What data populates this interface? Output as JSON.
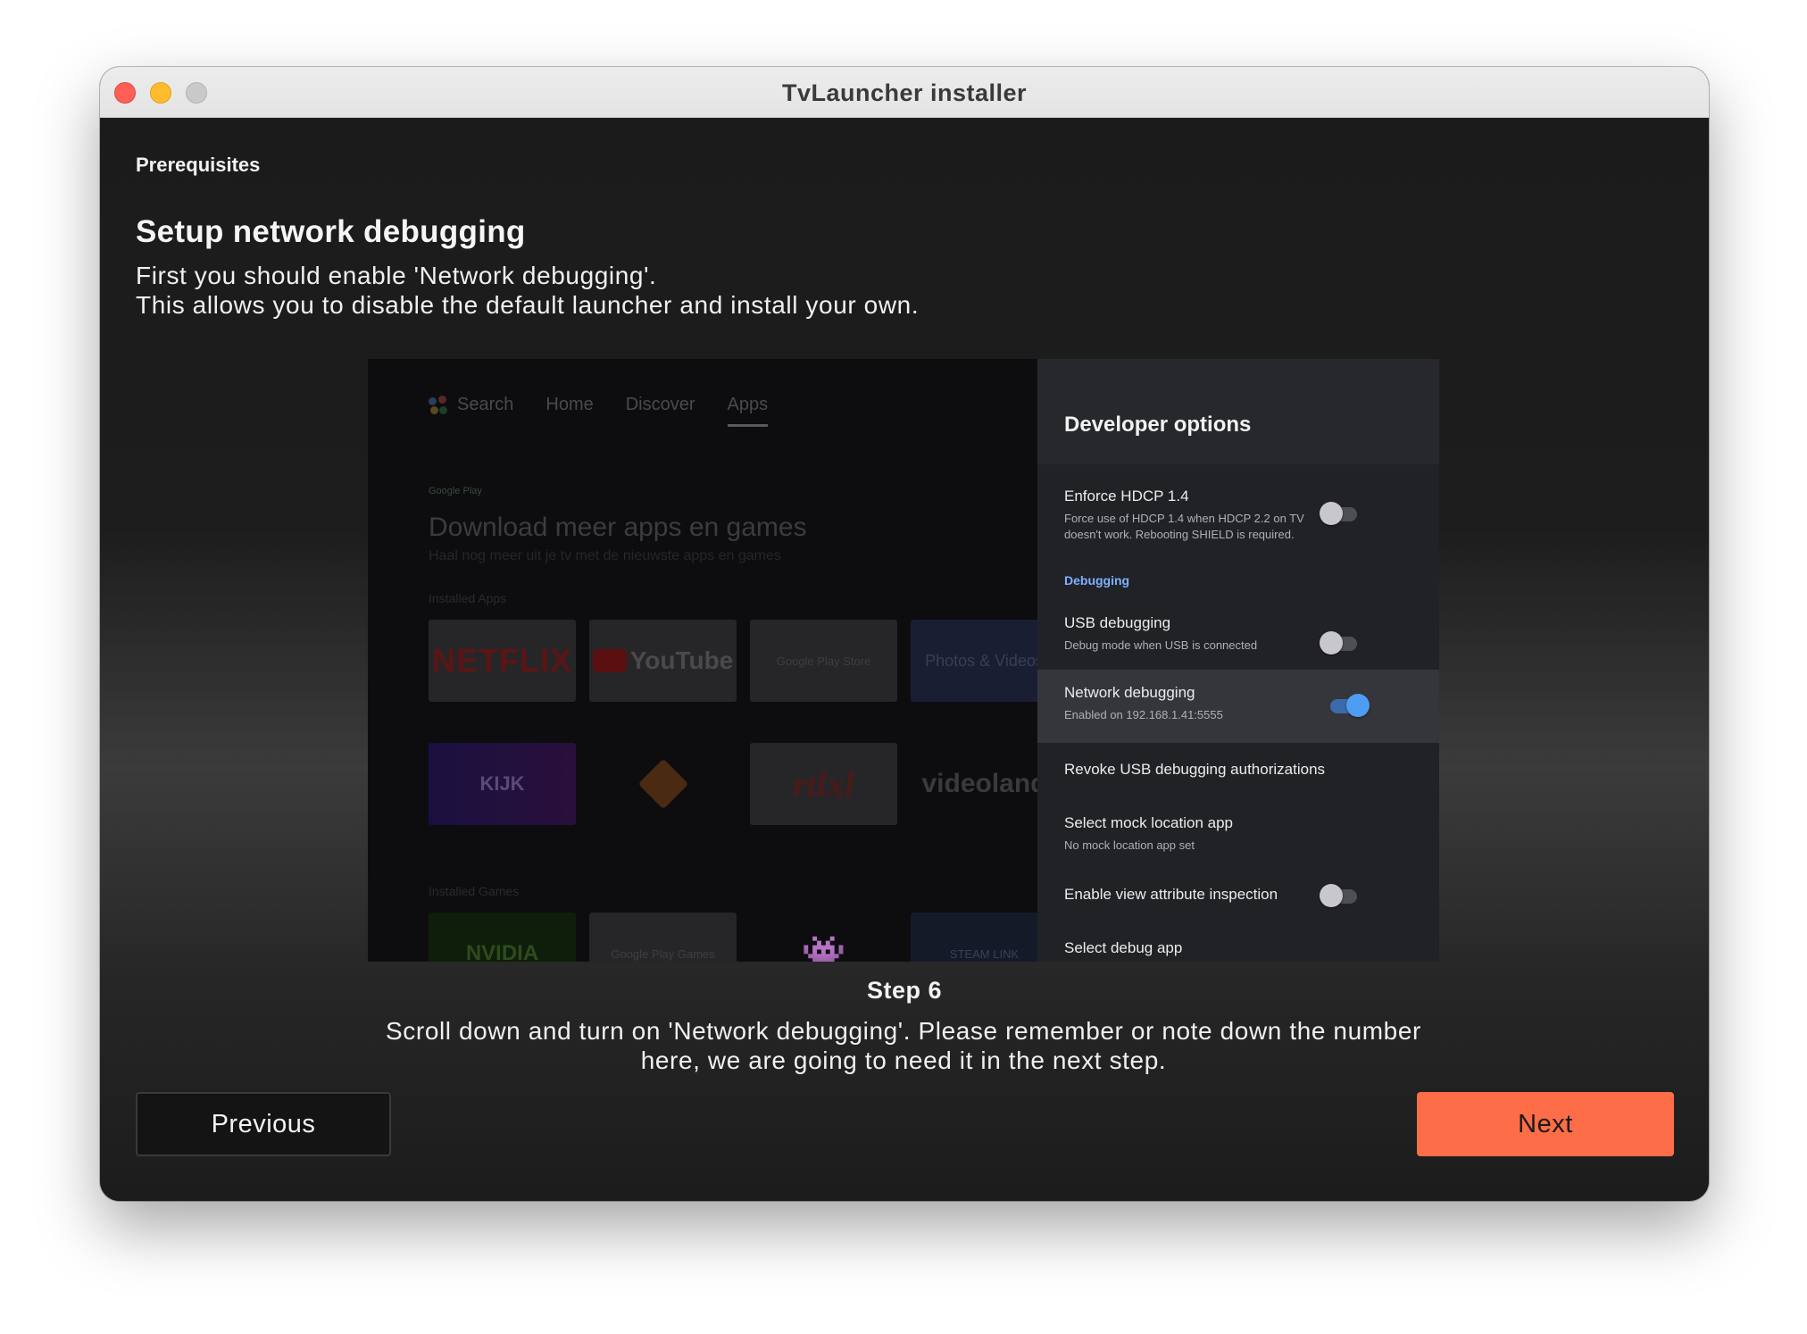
{
  "window": {
    "title": "TvLauncher installer"
  },
  "breadcrumb": "Prerequisites",
  "page": {
    "heading": "Setup network debugging",
    "description_line1": "First you should enable 'Network debugging'.",
    "description_line2": "This allows you to disable the default launcher and install your own."
  },
  "tv": {
    "nav": {
      "search": "Search",
      "home": "Home",
      "discover": "Discover",
      "apps": "Apps"
    },
    "google_play": "Google Play",
    "headline": "Download meer apps en games",
    "subline": "Haal nog meer uit je tv met de nieuwste apps en games",
    "installed_apps": "Installed Apps",
    "installed_games": "Installed Games",
    "tiles": {
      "netflix": "NETFLIX",
      "youtube": "YouTube",
      "google_play_store": "Google Play Store",
      "photos": "Photos & Videos",
      "kijk": "KIJK",
      "rtlxl": "rtlxl",
      "videoland": "videoland",
      "nvidia": "NVIDIA",
      "google_play_games": "Google Play Games",
      "steam_link": "STEAM LINK"
    }
  },
  "developer_options": {
    "title": "Developer options",
    "enforce_hdcp": {
      "label": "Enforce HDCP 1.4",
      "sub": "Force use of HDCP 1.4 when HDCP 2.2 on TV doesn't work. Rebooting SHIELD is required.",
      "on": false
    },
    "category": "Debugging",
    "usb_debugging": {
      "label": "USB debugging",
      "sub": "Debug mode when USB is connected",
      "on": false
    },
    "network_debugging": {
      "label": "Network debugging",
      "sub": "Enabled on 192.168.1.41:5555",
      "on": true
    },
    "revoke": {
      "label": "Revoke USB debugging authorizations"
    },
    "mock_location": {
      "label": "Select mock location app",
      "sub": "No mock location app set"
    },
    "view_attribute": {
      "label": "Enable view attribute inspection",
      "on": false
    },
    "debug_app": {
      "label": "Select debug app"
    }
  },
  "step": {
    "title": "Step 6",
    "description": "Scroll down and turn on 'Network debugging'. Please remember or note down the number here, we are going to need it in the next step."
  },
  "buttons": {
    "previous": "Previous",
    "next": "Next"
  },
  "colors": {
    "accent": "#fd6d48",
    "toggle_on": "#4f9cf3",
    "category": "#7cb2ff"
  }
}
